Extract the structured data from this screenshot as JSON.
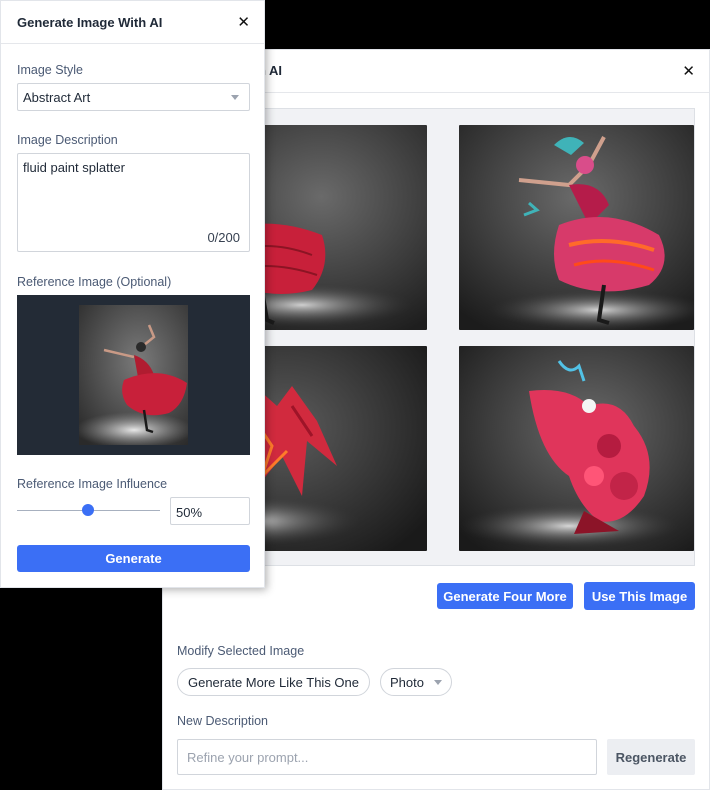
{
  "back_panel": {
    "title": "Generate Image With AI",
    "title_visible": "e With AI",
    "generate_four_more": "Generate Four More",
    "use_this_image": "Use This Image",
    "modify_label": "Modify Selected Image",
    "generate_more_like": "Generate More Like This One",
    "style_option": "Photo",
    "new_description_label": "New Description",
    "refine_placeholder": "Refine your prompt...",
    "regenerate": "Regenerate"
  },
  "front_panel": {
    "title": "Generate Image With AI",
    "image_style_label": "Image Style",
    "image_style_value": "Abstract Art",
    "image_description_label": "Image Description",
    "image_description_value": "fluid paint splatter",
    "char_counter": "0/200",
    "reference_image_label": "Reference Image (Optional)",
    "influence_label": "Reference Image Influence",
    "influence_value": "50%",
    "influence_fraction": 0.5,
    "generate": "Generate"
  },
  "colors": {
    "accent": "#3b6ff5",
    "dress_red": "#c8203a",
    "backdrop": "#2e2e2e"
  }
}
